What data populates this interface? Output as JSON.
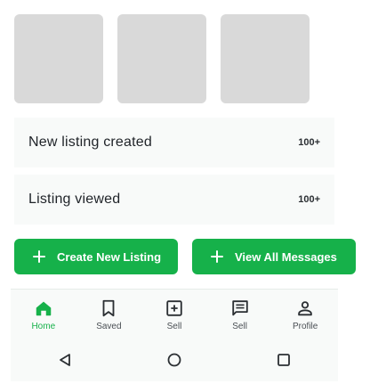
{
  "thumbnails": [
    {
      "color": "#d9d9d9"
    },
    {
      "color": "#d9d9d9"
    },
    {
      "color": "#d9d9d9"
    }
  ],
  "stats": [
    {
      "label": "New listing created",
      "count": "100+"
    },
    {
      "label": "Listing viewed",
      "count": "100+"
    }
  ],
  "actions": {
    "create_label": "Create New Listing",
    "messages_label": "View All Messages",
    "accent": "#16b14a"
  },
  "bottom_nav": {
    "items": [
      {
        "label": "Home",
        "icon": "home-icon",
        "active": true
      },
      {
        "label": "Saved",
        "icon": "bookmark-icon",
        "active": false
      },
      {
        "label": "Sell",
        "icon": "add-box-icon",
        "active": false
      },
      {
        "label": "Sell",
        "icon": "message-icon",
        "active": false
      },
      {
        "label": "Profile",
        "icon": "person-icon",
        "active": false
      }
    ]
  },
  "system_nav": {
    "buttons": [
      "back-icon",
      "home-circle-icon",
      "recents-icon"
    ]
  }
}
